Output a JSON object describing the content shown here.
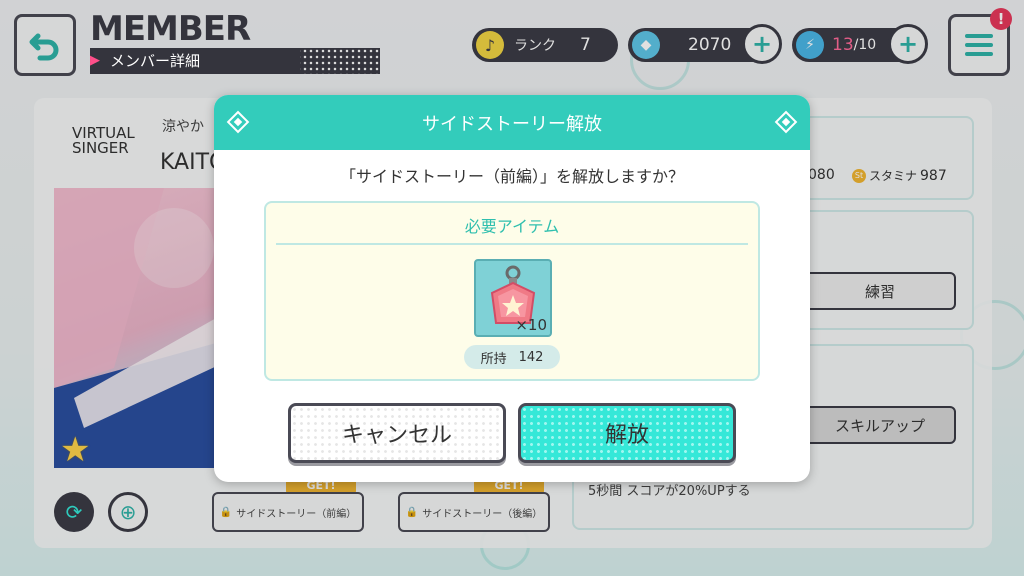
{
  "header": {
    "title": "MEMBER",
    "subtitle": "メンバー詳細",
    "rank_label": "ランク",
    "rank_value": "7",
    "crystal_count": "2070",
    "stamina_current": "13",
    "stamina_max": "/10"
  },
  "card": {
    "unit_logo_line1": "VIRTUAL",
    "unit_logo_line2": "SINGER",
    "card_subtitle": "涼やか",
    "character_name": "KAITO"
  },
  "side_panel": {
    "stat_value_partial": "080",
    "stamina_stat_label": "スタミナ",
    "stamina_stat_value": "987",
    "practice_button": "練習",
    "skill_up_button": "スキルアップ",
    "skill_description": "5秒間 スコアが20%UPする"
  },
  "bottom_bar": {
    "story_front_button": "サイドストーリー（前編）",
    "story_back_button": "サイドストーリー（後編）",
    "get_tag": "GET!"
  },
  "modal": {
    "title": "サイドストーリー解放",
    "question": "「サイドストーリー（前編）」を解放しますか？",
    "required_items_title": "必要アイテム",
    "item_quantity": "×10",
    "owned_label": "所持",
    "owned_count": "142",
    "cancel_button": "キャンセル",
    "unlock_button": "解放"
  },
  "colors": {
    "accent_teal": "#33ccbb",
    "dark_frame": "#3c3c46",
    "unlock_button": "#35e8d8",
    "notification_red": "#e8385c"
  }
}
